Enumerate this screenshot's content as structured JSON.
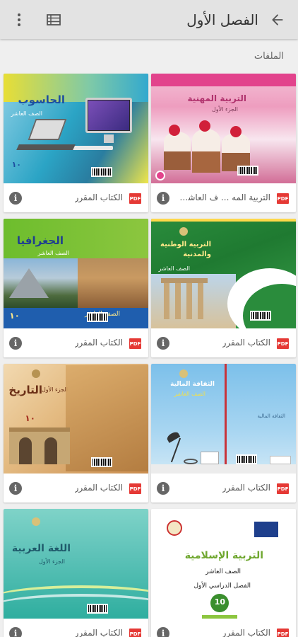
{
  "appbar": {
    "title": "الفصل الأول",
    "back_icon": "arrow-back-icon",
    "list_icon": "list-view-icon",
    "more_icon": "more-vert-icon"
  },
  "section": {
    "label": "الملفات"
  },
  "pdf_badge": "PDF",
  "colors": {
    "pdf_red": "#e53935",
    "appbar": "#e3e3e3",
    "info_grey": "#666666"
  },
  "books": [
    {
      "file_label": "التربية المه ... ف العاشر.pdf",
      "cover_title": "التربية المهنية",
      "cover_sub": "الجزء الأول"
    },
    {
      "file_label": "الكتاب المقرر",
      "cover_title": "الحاسوب",
      "cover_sub": "الصف العاشر",
      "cover_num": "١٠"
    },
    {
      "file_label": "الكتاب المقرر",
      "cover_title": "التربية الوطنية والمدنية",
      "cover_sub": "الصف العاشر"
    },
    {
      "file_label": "الكتاب المقرر",
      "cover_title": "الجغرافيا",
      "cover_sub": "الصف العاشر",
      "cover_num": "١٠"
    },
    {
      "file_label": "الكتاب المقرر",
      "cover_title": "الثقافة المالية",
      "cover_sub": "الصف العاشر"
    },
    {
      "file_label": "الكتاب المقرر",
      "cover_title": "التاريخ",
      "cover_sub": "الجزء الأول",
      "cover_num": "١٠"
    },
    {
      "file_label": "الكتاب المقرر",
      "cover_title": "التربية الإسلامية",
      "cover_sub": "الصف العاشر",
      "cover_sub2": "الفصل الدراسي الأول",
      "cover_num": "10"
    },
    {
      "file_label": "الكتاب المقرر",
      "cover_title": "اللغة العربية",
      "cover_sub": "الجزء الأول"
    }
  ]
}
